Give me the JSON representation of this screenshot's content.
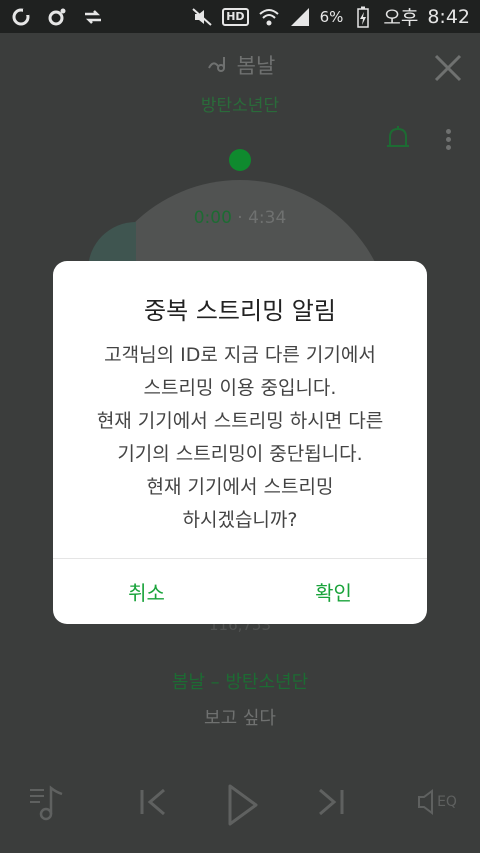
{
  "status_bar": {
    "battery_percent": "6%",
    "ampm": "오후",
    "time": "8:42",
    "hd_label": "HD"
  },
  "player": {
    "song_title": "봄날",
    "artist": "방탄소년단",
    "current_time": "0:00",
    "separator": "·",
    "total_time": "4:34",
    "hidden_count": "116,753",
    "now_playing": "봄날 – 방탄소년단",
    "lyric": "보고 싶다",
    "eq_label": "EQ"
  },
  "dialog": {
    "title": "중복 스트리밍 알림",
    "body_lines": [
      "고객님의 ID로 지금 다른 기기에서",
      "스트리밍 이용 중입니다.",
      "현재 기기에서 스트리밍 하시면 다른",
      "기기의 스트리밍이 중단됩니다.",
      "현재 기기에서 스트리밍",
      "하시겠습니까?"
    ],
    "cancel_label": "취소",
    "ok_label": "확인"
  },
  "colors": {
    "accent": "#1aa33b",
    "dim_accent": "#1d6b33"
  }
}
